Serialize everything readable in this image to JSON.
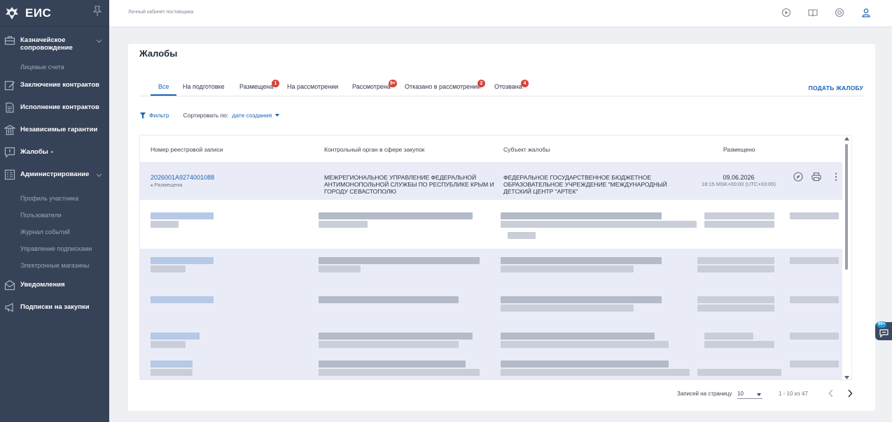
{
  "app": {
    "name": "ЕИС"
  },
  "topbar": {
    "breadcrumb": "Личный кабинет поставщика"
  },
  "sidebar": {
    "items": [
      {
        "label": "Казначейское сопровождение",
        "icon": "briefcase-icon",
        "expandable": true
      },
      {
        "label": "Лицевые счета",
        "sub": true
      },
      {
        "label": "Заключение контрактов",
        "icon": "edit-icon"
      },
      {
        "label": "Исполнение контрактов",
        "icon": "document-icon"
      },
      {
        "label": "Независимые гарантии",
        "icon": "bank-icon"
      },
      {
        "label": "Жалобы",
        "icon": "complaint-icon",
        "active": true
      },
      {
        "label": "Администрирование",
        "icon": "admin-icon",
        "expandable": true
      },
      {
        "label": "Профиль участника",
        "sub": true
      },
      {
        "label": "Пользователи",
        "sub": true
      },
      {
        "label": "Журнал событий",
        "sub": true
      },
      {
        "label": "Управление подписками",
        "sub": true
      },
      {
        "label": "Электронные магазины",
        "sub": true
      },
      {
        "label": "Уведомления",
        "icon": "envelope-icon"
      },
      {
        "label": "Подписки на закупки",
        "icon": "megaphone-icon"
      }
    ]
  },
  "page": {
    "title": "Жалобы",
    "submit_label": "ПОДАТЬ ЖАЛОБУ",
    "tabs": [
      {
        "label": "Все",
        "active": true
      },
      {
        "label": "На подготовке"
      },
      {
        "label": "Размещена",
        "badge": "1"
      },
      {
        "label": "На рассмотрении"
      },
      {
        "label": "Рассмотрена",
        "badge": "9+"
      },
      {
        "label": "Отказано в рассмотрении",
        "badge": "2"
      },
      {
        "label": "Отозвана",
        "badge": "4"
      }
    ],
    "filter_label": "Фильтр",
    "sort_label": "Сортировать по:",
    "sort_value": "дате создания"
  },
  "table": {
    "headers": [
      "Номер реестровой записи",
      "Контрольный орган в сфере закупок",
      "Субъект жалобы",
      "Размещено"
    ],
    "rows": [
      {
        "number": "2026001A9274001088",
        "status": "Размещена",
        "control_body": "МЕЖРЕГИОНАЛЬНОЕ УПРАВЛЕНИЕ ФЕДЕРАЛЬНОЙ АНТИМОНОПОЛЬНОЙ СЛУЖБЫ ПО РЕСПУБЛИКЕ КРЫМ И ГОРОДУ СЕВАСТОПОЛЮ",
        "subject": "ФЕДЕРАЛЬНОЕ ГОСУДАРСТВЕННОЕ БЮДЖЕТНОЕ ОБРАЗОВАТЕЛЬНОЕ УЧРЕЖДЕНИЕ \"МЕЖДУНАРОДНЫЙ ДЕТСКИЙ ЦЕНТР \"АРТЕК\"",
        "date": "09.06.2026",
        "time": "18:15 MSK+00:00 (UTC+03:00)"
      }
    ]
  },
  "pager": {
    "per_page_label": "Записей на страницу",
    "per_page": "10",
    "range": "1 - 10 из 47"
  },
  "chat": {
    "badge": "99+"
  },
  "colors": {
    "sidebar": "#364257",
    "accent": "#1a63b5",
    "badge": "#d9423a",
    "row_highlight": "#e9ecf7"
  }
}
